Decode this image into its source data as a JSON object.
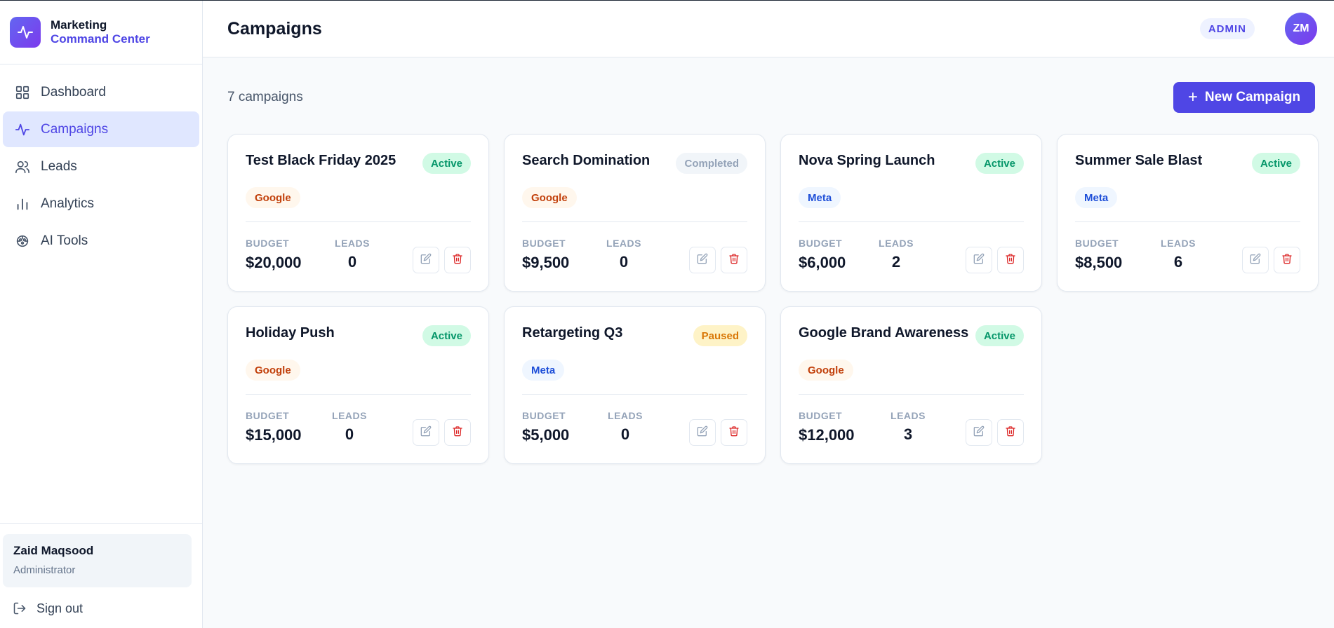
{
  "brand": {
    "line1": "Marketing",
    "line2": "Command Center",
    "logo_icon": "activity-icon"
  },
  "nav": [
    {
      "label": "Dashboard",
      "icon": "grid-icon",
      "active": false
    },
    {
      "label": "Campaigns",
      "icon": "activity-icon",
      "active": true
    },
    {
      "label": "Leads",
      "icon": "users-icon",
      "active": false
    },
    {
      "label": "Analytics",
      "icon": "bar-chart-icon",
      "active": false
    },
    {
      "label": "AI Tools",
      "icon": "brain-icon",
      "active": false
    }
  ],
  "user": {
    "name": "Zaid Maqsood",
    "role": "Administrator"
  },
  "signout_label": "Sign out",
  "header": {
    "title": "Campaigns",
    "role_badge": "ADMIN",
    "avatar_initials": "ZM"
  },
  "main": {
    "count_text": "7 campaigns",
    "new_button_label": "New Campaign"
  },
  "labels": {
    "budget": "BUDGET",
    "leads": "LEADS"
  },
  "colors": {
    "accent": "#4f46e5",
    "active": "#059669",
    "paused": "#d97706",
    "delete": "#dc2626"
  },
  "campaigns": [
    {
      "name": "Test Black Friday 2025",
      "status": "Active",
      "platform": "Google",
      "budget": "$20,000",
      "leads": "0"
    },
    {
      "name": "Search Domination",
      "status": "Completed",
      "platform": "Google",
      "budget": "$9,500",
      "leads": "0"
    },
    {
      "name": "Nova Spring Launch",
      "status": "Active",
      "platform": "Meta",
      "budget": "$6,000",
      "leads": "2"
    },
    {
      "name": "Summer Sale Blast",
      "status": "Active",
      "platform": "Meta",
      "budget": "$8,500",
      "leads": "6"
    },
    {
      "name": "Holiday Push",
      "status": "Active",
      "platform": "Google",
      "budget": "$15,000",
      "leads": "0"
    },
    {
      "name": "Retargeting Q3",
      "status": "Paused",
      "platform": "Meta",
      "budget": "$5,000",
      "leads": "0"
    },
    {
      "name": "Google Brand Awareness",
      "status": "Active",
      "platform": "Google",
      "budget": "$12,000",
      "leads": "3"
    }
  ]
}
